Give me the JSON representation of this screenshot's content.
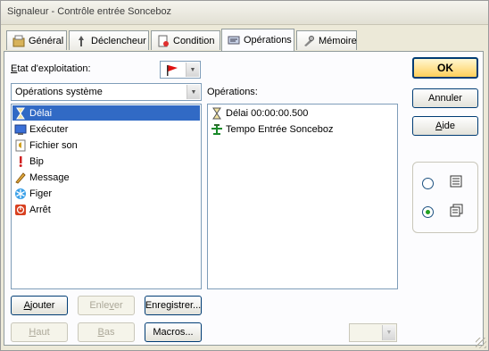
{
  "window": {
    "title": "Signaleur - Contrôle entrée Sonceboz"
  },
  "tabs": [
    {
      "label": "Général",
      "icon": "general-icon",
      "active": false
    },
    {
      "label": "Déclencheur",
      "icon": "trigger-icon",
      "active": false
    },
    {
      "label": "Condition",
      "icon": "condition-icon",
      "active": false
    },
    {
      "label": "Opérations",
      "icon": "operations-icon",
      "active": true
    },
    {
      "label": "Mémoire",
      "icon": "memory-icon",
      "active": false
    }
  ],
  "etat": {
    "label": "Etat d'exploitation:",
    "accesskey": "E",
    "label_rest": "tat d'exploitation:",
    "flag_color": "#e01010"
  },
  "category_combo": {
    "value": "Opérations système"
  },
  "available_list": {
    "items": [
      {
        "label": "Délai",
        "icon": "hourglass-icon",
        "selected": true
      },
      {
        "label": "Exécuter",
        "icon": "execute-icon",
        "selected": false
      },
      {
        "label": "Fichier son",
        "icon": "sound-file-icon",
        "selected": false
      },
      {
        "label": "Bip",
        "icon": "beep-icon",
        "selected": false
      },
      {
        "label": "Message",
        "icon": "message-icon",
        "selected": false
      },
      {
        "label": "Figer",
        "icon": "freeze-icon",
        "selected": false
      },
      {
        "label": "Arrêt",
        "icon": "stop-icon",
        "selected": false
      }
    ]
  },
  "operations": {
    "label": "Opérations:",
    "items": [
      {
        "label": "Délai 00:00:00.500",
        "icon": "hourglass-icon"
      },
      {
        "label": "Tempo Entrée Sonceboz",
        "icon": "tempo-icon"
      }
    ]
  },
  "buttons": {
    "ajouter": {
      "pre": "",
      "key": "A",
      "post": "jouter"
    },
    "enlever": {
      "pre": "Enle",
      "key": "v",
      "post": "er"
    },
    "enregistrer": {
      "label": "Enregistrer..."
    },
    "haut": {
      "pre": "",
      "key": "H",
      "post": "aut"
    },
    "bas": {
      "pre": "",
      "key": "B",
      "post": "as"
    },
    "macros": {
      "label": "Macros..."
    },
    "ok": {
      "label": "OK"
    },
    "annuler": {
      "label": "Annuler"
    },
    "aide": {
      "pre": "",
      "key": "A",
      "post": "ide"
    }
  },
  "view_mode": {
    "list_checked": false,
    "detail_checked": true
  },
  "colors": {
    "selection": "#316ac5",
    "accent_border": "#003c74"
  }
}
